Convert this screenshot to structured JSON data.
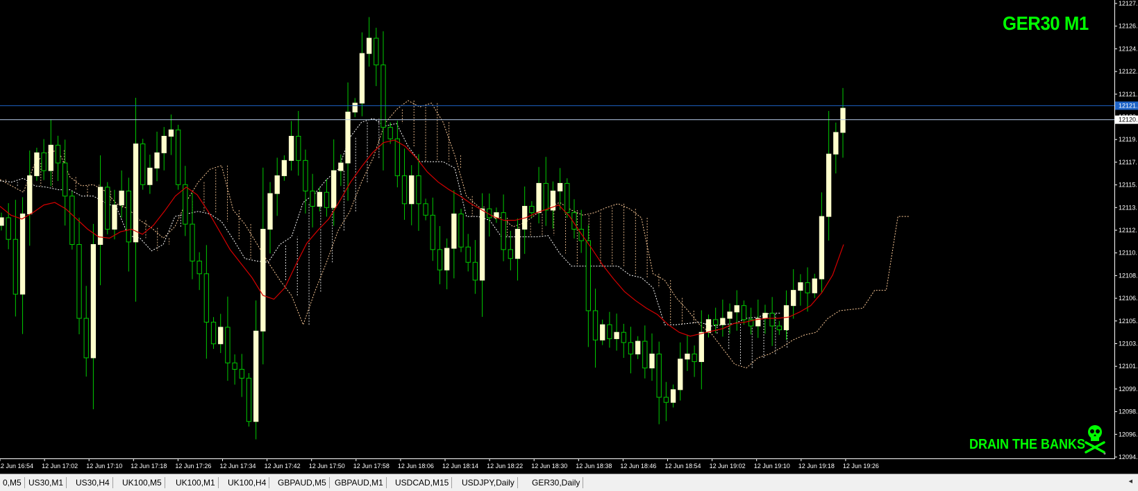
{
  "window": {
    "symbol_title": "GER30 M1",
    "watermark_text": "DRAIN THE BANKS",
    "watermark_icon": "skull-crossbones-icon"
  },
  "colors": {
    "background": "#000000",
    "candle_bull_body": "#ffffcc",
    "candle_wick": "#00cc00",
    "moving_average": "#d60000",
    "cloud_line_a": "#ffcc99",
    "cloud_line_b": "#ffffff",
    "hline_blue": "#1e64c8",
    "hline_light": "#b4c8e6",
    "title_green": "#00ff00"
  },
  "chart_data": {
    "type": "candlestick",
    "price_axis_ticks": [
      "12127.",
      "12126.",
      "12124.",
      "12122.",
      "12121.",
      "12120.",
      "12119.",
      "12117.",
      "12115.",
      "12113.",
      "12112.",
      "12110.",
      "12108.",
      "12106.",
      "12105.",
      "12103.",
      "12101.",
      "12099.",
      "12098.",
      "12096.",
      "12094."
    ],
    "highlight_price_labels": [
      {
        "text": "12121.",
        "style": "blue"
      },
      {
        "text": "12120.",
        "style": "white"
      }
    ],
    "time_labels": [
      "12 Jun 16:54",
      "12 Jun 17:02",
      "12 Jun 17:10",
      "12 Jun 17:18",
      "12 Jun 17:26",
      "12 Jun 17:34",
      "12 Jun 17:42",
      "12 Jun 17:50",
      "12 Jun 17:58",
      "12 Jun 18:06",
      "12 Jun 18:14",
      "12 Jun 18:22",
      "12 Jun 18:30",
      "12 Jun 18:38",
      "12 Jun 18:46",
      "12 Jun 18:54",
      "12 Jun 19:02",
      "12 Jun 19:10",
      "12 Jun 19:18",
      "12 Jun 19:26"
    ],
    "ylim": [
      12093.6,
      12129.6
    ],
    "horizontal_lines": [
      12121.3,
      12120.2
    ],
    "close": [
      12112.5,
      12110.8,
      12106.5,
      12112.8,
      12115.8,
      12117.6,
      12116.2,
      12118.2,
      12116.8,
      12114.2,
      12110.4,
      12104.6,
      12101.5,
      12110.4,
      12114.9,
      12111.6,
      12113.5,
      12114.6,
      12110.6,
      12118.3,
      12115.1,
      12116.4,
      12117.6,
      12118.9,
      12119.4,
      12115.1,
      12112.0,
      12109.1,
      12108.1,
      12104.3,
      12102.6,
      12103.9,
      12101.1,
      12100.6,
      12099.9,
      12096.5,
      12103.6,
      12111.6,
      12114.4,
      12115.8,
      12117.0,
      12118.9,
      12117.0,
      12114.6,
      12113.4,
      12114.5,
      12113.3,
      12116.2,
      12116.8,
      12120.8,
      12121.5,
      12125.4,
      12126.6,
      12124.5,
      12119.6,
      12118.7,
      12115.8,
      12113.6,
      12115.8,
      12113.6,
      12112.7,
      12110.0,
      12108.4,
      12110.1,
      12112.8,
      12110.2,
      12109.0,
      12107.6,
      12113.2,
      12112.5,
      12112.9,
      12110.0,
      12109.3,
      12111.6,
      12113.4,
      12112.9,
      12115.2,
      12113.1,
      12114.6,
      12115.2,
      12112.9,
      12111.6,
      12110.7,
      12105.2,
      12102.9,
      12104.1,
      12103.0,
      12103.5,
      12102.7,
      12101.8,
      12102.8,
      12100.7,
      12101.8,
      12098.4,
      12098.0,
      12099.0,
      12101.4,
      12101.8,
      12101.2,
      12103.5,
      12104.5,
      12104.1,
      12104.6,
      12105.1,
      12105.6,
      12104.5,
      12104.0,
      12104.6,
      12105.0,
      12104.0,
      12103.7,
      12105.6,
      12106.8,
      12107.4,
      12106.6,
      12107.7,
      12112.6,
      12117.5,
      12119.2,
      12121.1
    ],
    "moving_average": [
      12113.4,
      12112.7,
      12112.4,
      12112.9,
      12113.5,
      12113.7,
      12113.2,
      12112.4,
      12111.6,
      12111.0,
      12110.9,
      12111.4,
      12111.6,
      12111.2,
      12111.9,
      12113.0,
      12114.2,
      12114.9,
      12114.3,
      12113.0,
      12111.5,
      12110.0,
      12108.9,
      12107.8,
      12106.4,
      12106.1,
      12107.0,
      12108.8,
      12110.5,
      12111.5,
      12112.4,
      12113.8,
      12115.3,
      12116.5,
      12117.6,
      12118.4,
      12118.6,
      12118.1,
      12117.2,
      12116.1,
      12115.3,
      12114.7,
      12114.2,
      12113.6,
      12113.1,
      12112.6,
      12112.3,
      12112.3,
      12112.5,
      12112.9,
      12113.2,
      12113.5,
      12112.6,
      12111.3,
      12110.1,
      12108.8,
      12107.7,
      12106.7,
      12106.0,
      12105.4,
      12104.9,
      12104.1,
      12103.5,
      12103.2,
      12103.4,
      12103.6,
      12103.8,
      12104.2,
      12104.3,
      12104.5,
      12104.6,
      12104.6,
      12104.7,
      12105.1,
      12105.6,
      12106.6,
      12108.0,
      12110.4
    ],
    "cloud_span_a": [
      12115.5,
      12115.0,
      12114.5,
      12116.8,
      12117.6,
      12117.8,
      12115.7,
      12115.0,
      12115.1,
      12114.6,
      12113.6,
      12113.2,
      12112.3,
      12111.7,
      12110.9,
      12111.8,
      12113.8,
      12115.3,
      12116.3,
      12116.6,
      12113.1,
      12112.0,
      12110.5,
      12109.0,
      12107.6,
      12106.4,
      12104.1,
      12106.7,
      12109.0,
      12111.5,
      12113.0,
      12115.3,
      12117.2,
      12119.9,
      12121.0,
      12121.7,
      12121.2,
      12121.5,
      12120.0,
      12117.4,
      12114.2,
      12113.4,
      12112.7,
      12112.5,
      12111.8,
      12112.1,
      12112.8,
      12113.3,
      12113.7,
      12113.1,
      12112.7,
      12112.9,
      12113.3,
      12113.6,
      12113.2,
      12112.5,
      12108.1,
      12107.6,
      12106.2,
      12105.2,
      12104.1,
      12103.4,
      12102.2,
      12101.0,
      12100.7,
      12101.5,
      12101.8,
      12102.3,
      12102.9,
      12103.3,
      12103.5,
      12104.6,
      12105.2,
      12105.3,
      12105.4,
      12106.8,
      12106.8,
      12112.6,
      12112.6
    ],
    "cloud_span_b": [
      12115.4,
      12115.3,
      12115.6,
      12115.0,
      12114.9,
      12114.7,
      12114.7,
      12114.2,
      12114.2,
      12113.7,
      12113.3,
      12111.1,
      12110.9,
      12109.9,
      12110.4,
      12112.6,
      12112.8,
      12113.0,
      12112.8,
      12112.2,
      12110.8,
      12109.3,
      12109.1,
      12109.0,
      12110.4,
      12111.0,
      12113.7,
      12114.4,
      12115.5,
      12116.3,
      12118.8,
      12120.0,
      12120.3,
      12119.7,
      12119.9,
      12118.1,
      12116.9,
      12116.9,
      12116.9,
      12116.4,
      12112.6,
      12112.6,
      12112.3,
      12111.0,
      12111.0,
      12111.0,
      12111.0,
      12111.1,
      12109.7,
      12108.7,
      12108.7,
      12108.7,
      12108.7,
      12108.7,
      12108.0,
      12107.8,
      12107.0,
      12104.1,
      12104.1,
      12104.2,
      12104.3,
      12104.0,
      12104.1,
      12104.2,
      12104.6,
      12104.7,
      12105.0,
      12105.0
    ]
  },
  "tabs": [
    {
      "label": "0,M5"
    },
    {
      "label": "US30,M1"
    },
    {
      "label": "US30,H4"
    },
    {
      "label": "UK100,M5"
    },
    {
      "label": "UK100,M1"
    },
    {
      "label": "UK100,H4"
    },
    {
      "label": "GBPAUD,M5"
    },
    {
      "label": "GBPAUD,M1"
    },
    {
      "label": "USDCAD,M15"
    },
    {
      "label": "USDJPY,Daily"
    },
    {
      "label": "GER30,Daily"
    }
  ],
  "tab_arrow": "◂"
}
